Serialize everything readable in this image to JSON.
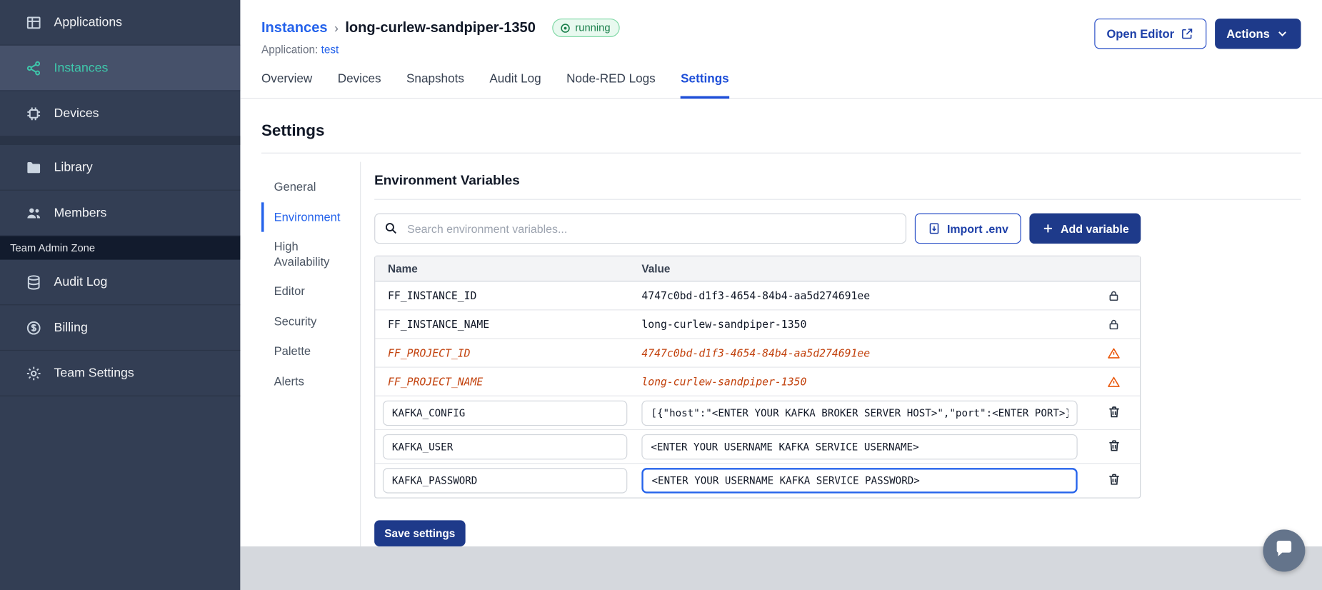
{
  "sidebar": {
    "items": [
      {
        "label": "Applications"
      },
      {
        "label": "Instances"
      },
      {
        "label": "Devices"
      },
      {
        "label": "Library"
      },
      {
        "label": "Members"
      }
    ],
    "section_label": "Team Admin Zone",
    "admin_items": [
      {
        "label": "Audit Log"
      },
      {
        "label": "Billing"
      },
      {
        "label": "Team Settings"
      }
    ]
  },
  "header": {
    "breadcrumb_root": "Instances",
    "breadcrumb_separator": "›",
    "instance_name": "long-curlew-sandpiper-1350",
    "status": "running",
    "application_label": "Application:",
    "application_name": "test",
    "open_editor_label": "Open Editor",
    "actions_label": "Actions"
  },
  "tabs": [
    "Overview",
    "Devices",
    "Snapshots",
    "Audit Log",
    "Node-RED Logs",
    "Settings"
  ],
  "active_tab": "Settings",
  "settings": {
    "title": "Settings",
    "subnav": [
      "General",
      "Environment",
      "High Availability",
      "Editor",
      "Security",
      "Palette",
      "Alerts"
    ],
    "active_subnav": "Environment",
    "section_title": "Environment Variables",
    "search_placeholder": "Search environment variables...",
    "import_label": "Import .env",
    "add_label": "Add variable",
    "save_label": "Save settings",
    "table": {
      "columns": [
        "Name",
        "Value"
      ],
      "rows": [
        {
          "name": "FF_INSTANCE_ID",
          "value": "4747c0bd-d1f3-4654-84b4-aa5d274691ee",
          "type": "locked"
        },
        {
          "name": "FF_INSTANCE_NAME",
          "value": "long-curlew-sandpiper-1350",
          "type": "locked"
        },
        {
          "name": "FF_PROJECT_ID",
          "value": "4747c0bd-d1f3-4654-84b4-aa5d274691ee",
          "type": "deprecated"
        },
        {
          "name": "FF_PROJECT_NAME",
          "value": "long-curlew-sandpiper-1350",
          "type": "deprecated"
        },
        {
          "name": "KAFKA_CONFIG",
          "value": "[{\"host\":\"<ENTER YOUR KAFKA BROKER SERVER HOST>\",\"port\":<ENTER PORT>}]",
          "type": "editable",
          "focused": false
        },
        {
          "name": "KAFKA_USER",
          "value": "<ENTER YOUR USERNAME KAFKA SERVICE USERNAME>",
          "type": "editable",
          "focused": false
        },
        {
          "name": "KAFKA_PASSWORD",
          "value": "<ENTER YOUR USERNAME KAFKA SERVICE PASSWORD>",
          "type": "editable",
          "focused": true
        }
      ]
    }
  },
  "colors": {
    "sidebar_bg": "#333e54",
    "accent_teal": "#3ec9ac",
    "primary_blue": "#1e3a8a",
    "link_blue": "#2563eb",
    "deprecated_orange": "#c2410c",
    "running_green": "#1a7f4b"
  }
}
